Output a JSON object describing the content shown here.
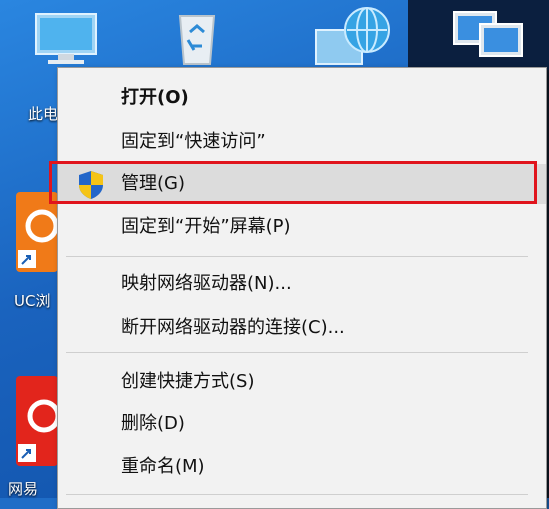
{
  "desktop": {
    "icons": [
      {
        "name": "this-pc",
        "label": "此电"
      },
      {
        "name": "recycle-bin",
        "label": ""
      },
      {
        "name": "network",
        "label": ""
      },
      {
        "name": "remote-network",
        "label": ""
      },
      {
        "name": "uc-browser",
        "label": "UC浏"
      },
      {
        "name": "netease",
        "label": "网易"
      }
    ]
  },
  "menu": {
    "items": [
      {
        "label": "打开(O)"
      },
      {
        "label": "固定到“快速访问”"
      },
      {
        "label": "管理(G)"
      },
      {
        "label": "固定到“开始”屏幕(P)"
      },
      {
        "label": "映射网络驱动器(N)..."
      },
      {
        "label": "断开网络驱动器的连接(C)..."
      },
      {
        "label": "创建快捷方式(S)"
      },
      {
        "label": "删除(D)"
      },
      {
        "label": "重命名(M)"
      }
    ]
  },
  "colors": {
    "highlight_border": "#e0141c",
    "menu_background": "#f2f2f2",
    "desktop": "#1f6dc7"
  }
}
